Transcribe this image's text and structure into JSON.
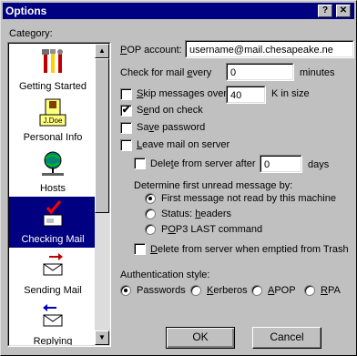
{
  "window": {
    "title": "Options",
    "help_glyph": "?",
    "close_glyph": "✕"
  },
  "category": {
    "label": "Category:",
    "items": [
      {
        "label": "Getting Started",
        "icon": "tools-icon",
        "selected": false
      },
      {
        "label": "Personal Info",
        "icon": "id-card-icon",
        "selected": false
      },
      {
        "label": "Hosts",
        "icon": "network-icon",
        "selected": false
      },
      {
        "label": "Checking Mail",
        "icon": "check-mailbox-icon",
        "selected": true
      },
      {
        "label": "Sending Mail",
        "icon": "send-mail-icon",
        "selected": false
      },
      {
        "label": "Replying",
        "icon": "reply-icon",
        "selected": false
      }
    ]
  },
  "settings": {
    "pop_account_label": "POP account:",
    "pop_account_value": "username@mail.chesapeake.ne",
    "check_every_label": "Check for mail every",
    "check_every_value": "0",
    "check_every_unit": "minutes",
    "skip_label": "Skip messages over",
    "skip_value": "40",
    "skip_unit": "K in size",
    "skip_checked": false,
    "send_on_check_label": "Send on check",
    "send_on_check_checked": true,
    "save_password_label": "Save password",
    "save_password_checked": false,
    "leave_mail_label": "Leave mail on server",
    "leave_mail_checked": false,
    "delete_after_label": "Delete from server after",
    "delete_after_value": "0",
    "delete_after_unit": "days",
    "delete_after_checked": false,
    "determine_label": "Determine first unread message by:",
    "unread_options": [
      {
        "label": "First message not read by this machine",
        "selected": true
      },
      {
        "label": "Status: headers",
        "selected": false
      },
      {
        "label": "POP3 LAST command",
        "selected": false
      }
    ],
    "delete_trash_label": "Delete from server when emptied from Trash",
    "delete_trash_checked": false,
    "auth_label": "Authentication style:",
    "auth_options": [
      {
        "label": "Passwords",
        "selected": true
      },
      {
        "label": "Kerberos",
        "selected": false
      },
      {
        "label": "APOP",
        "selected": false
      },
      {
        "label": "RPA",
        "selected": false
      }
    ]
  },
  "buttons": {
    "ok": "OK",
    "cancel": "Cancel"
  },
  "check_glyph": "✔"
}
